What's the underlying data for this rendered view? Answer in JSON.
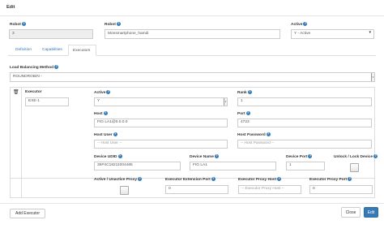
{
  "dialog": {
    "title": "Edit"
  },
  "robot_id": {
    "label": "Robot",
    "value": "3"
  },
  "robot_name": {
    "label": "Robot",
    "value": "Monsmartphone_hamdi"
  },
  "active": {
    "label": "Active",
    "value": "Y - Active"
  },
  "tabs": [
    {
      "label": "Definition"
    },
    {
      "label": "Capabilities"
    },
    {
      "label": "Executors"
    }
  ],
  "load_balancing": {
    "label": "Load Balancing Method",
    "value": "ROUNDROBIN -"
  },
  "executor": {
    "executor": {
      "label": "Executor",
      "value": "EXE-1"
    },
    "active": {
      "label": "Active",
      "value": "Y"
    },
    "rank": {
      "label": "Rank",
      "value": "1"
    },
    "host": {
      "label": "Host",
      "value": "FIG LA1@0.0.0.0"
    },
    "port": {
      "label": "Port",
      "value": "4723"
    },
    "host_user": {
      "label": "Host User",
      "placeholder": "-- Host User --"
    },
    "host_password": {
      "label": "Host Password",
      "placeholder": "-- Host Password --"
    },
    "device_udid": {
      "label": "Device UDID",
      "value": "35P4C18211004485"
    },
    "device_name": {
      "label": "Device Name",
      "value": "FIG LA1"
    },
    "device_port": {
      "label": "Device Port",
      "value": "1"
    },
    "unlock_lock_device": {
      "label": "Unlock / Lock Device"
    },
    "active_inactive_proxy": {
      "label": "Active / Unactive Proxy"
    },
    "executor_extension_port": {
      "label": "Executor Extension Port",
      "value": "0"
    },
    "executor_proxy_host": {
      "label": "Executor Proxy Host",
      "placeholder": "-- Executor Proxy Host --"
    },
    "executor_proxy_port": {
      "label": "Executor Proxy Port",
      "value": "0"
    }
  },
  "buttons": {
    "add_executor": "Add Executor",
    "close": "Close",
    "edit": "Edit"
  },
  "colors": {
    "primary": "#337ab7",
    "help_icon": "#337ab7"
  },
  "icons": {
    "help": "question-circle-icon",
    "delete": "trash-icon",
    "dropdown": "chevron-down-icon"
  }
}
